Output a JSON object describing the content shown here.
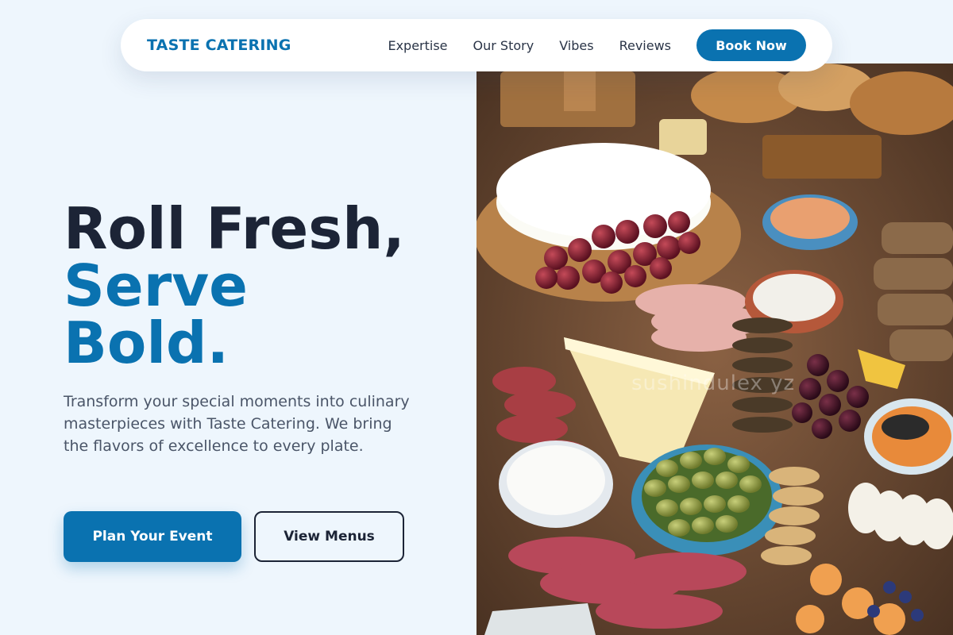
{
  "brand": {
    "name": "TASTE CATERING",
    "color": "#0a72b0"
  },
  "nav": {
    "links": [
      "Expertise",
      "Our Story",
      "Vibes",
      "Reviews"
    ],
    "cta_label": "Book Now"
  },
  "hero": {
    "title_line1": "Roll Fresh,",
    "title_line2": "Serve",
    "title_line3": "Bold.",
    "description": "Transform your special moments into culinary masterpieces with Taste Catering. We bring the flavors of excellence to every plate.",
    "primary_cta": "Plan Your Event",
    "secondary_cta": "View Menus",
    "image_watermark": "sushindulex yz"
  },
  "colors": {
    "accent": "#0a72b0",
    "heading": "#1c2436",
    "background": "#eef6fd"
  }
}
